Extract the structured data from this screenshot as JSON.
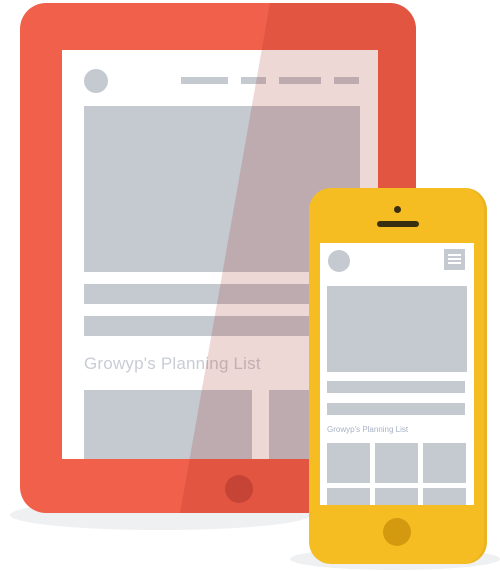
{
  "tablet": {
    "device_color": "#f0604a",
    "home_button_color": "#c54436",
    "nav_items": [
      "nav-item-1",
      "nav-item-2",
      "nav-item-3",
      "nav-item-4"
    ],
    "title": "Growyp's Planning List"
  },
  "phone": {
    "device_color": "#f6bd23",
    "home_button_color": "#d49a0f",
    "menu_icon": "hamburger-menu-icon",
    "title": "Growyp's Planning List"
  },
  "placeholder_color": "#c5c9d0"
}
